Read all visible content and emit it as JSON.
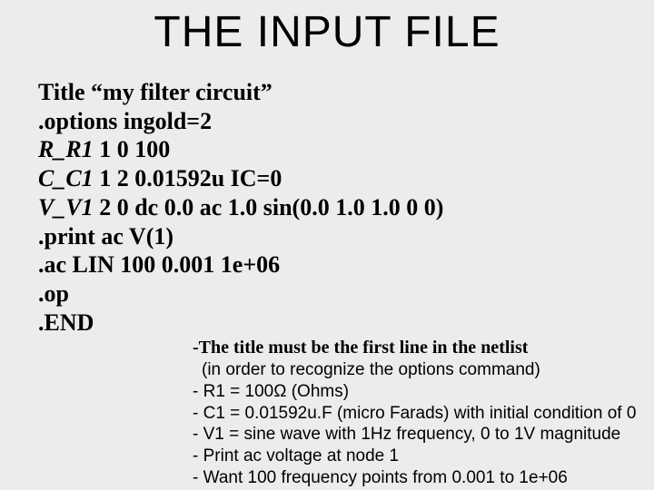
{
  "title": "THE INPUT FILE",
  "netlist": {
    "l0a": "Title ",
    "l0b": "“my filter circuit”",
    "l1": ".options ingold=2",
    "l2a": "R_R1",
    "l2b": " 1 0 100",
    "l3a": "C_C1",
    "l3b": " 1 2 0.01592u IC=0",
    "l4a": "V_V1",
    "l4b": " 2 0 dc 0.0 ac 1.0 sin(0.0 1.0 1.0 0 0)",
    "l5": ".print ac V(1)",
    "l6": ".ac LIN 100 0.001 1e+06",
    "l7": ".op",
    "l8": ".END"
  },
  "notes": {
    "n0": "-The title must be the first line in the netlist",
    "n1": "(in order to recognize the options command)",
    "n2": "- R1 = 100Ω (Ohms)",
    "n3": "- C1 = 0.01592u.F (micro Farads) with initial condition of 0",
    "n4": "- V1 = sine wave with 1Hz frequency, 0 to 1V magnitude",
    "n5": "- Print ac voltage at node 1",
    "n6": "- Want 100 frequency points from 0.001 to 1e+06"
  }
}
